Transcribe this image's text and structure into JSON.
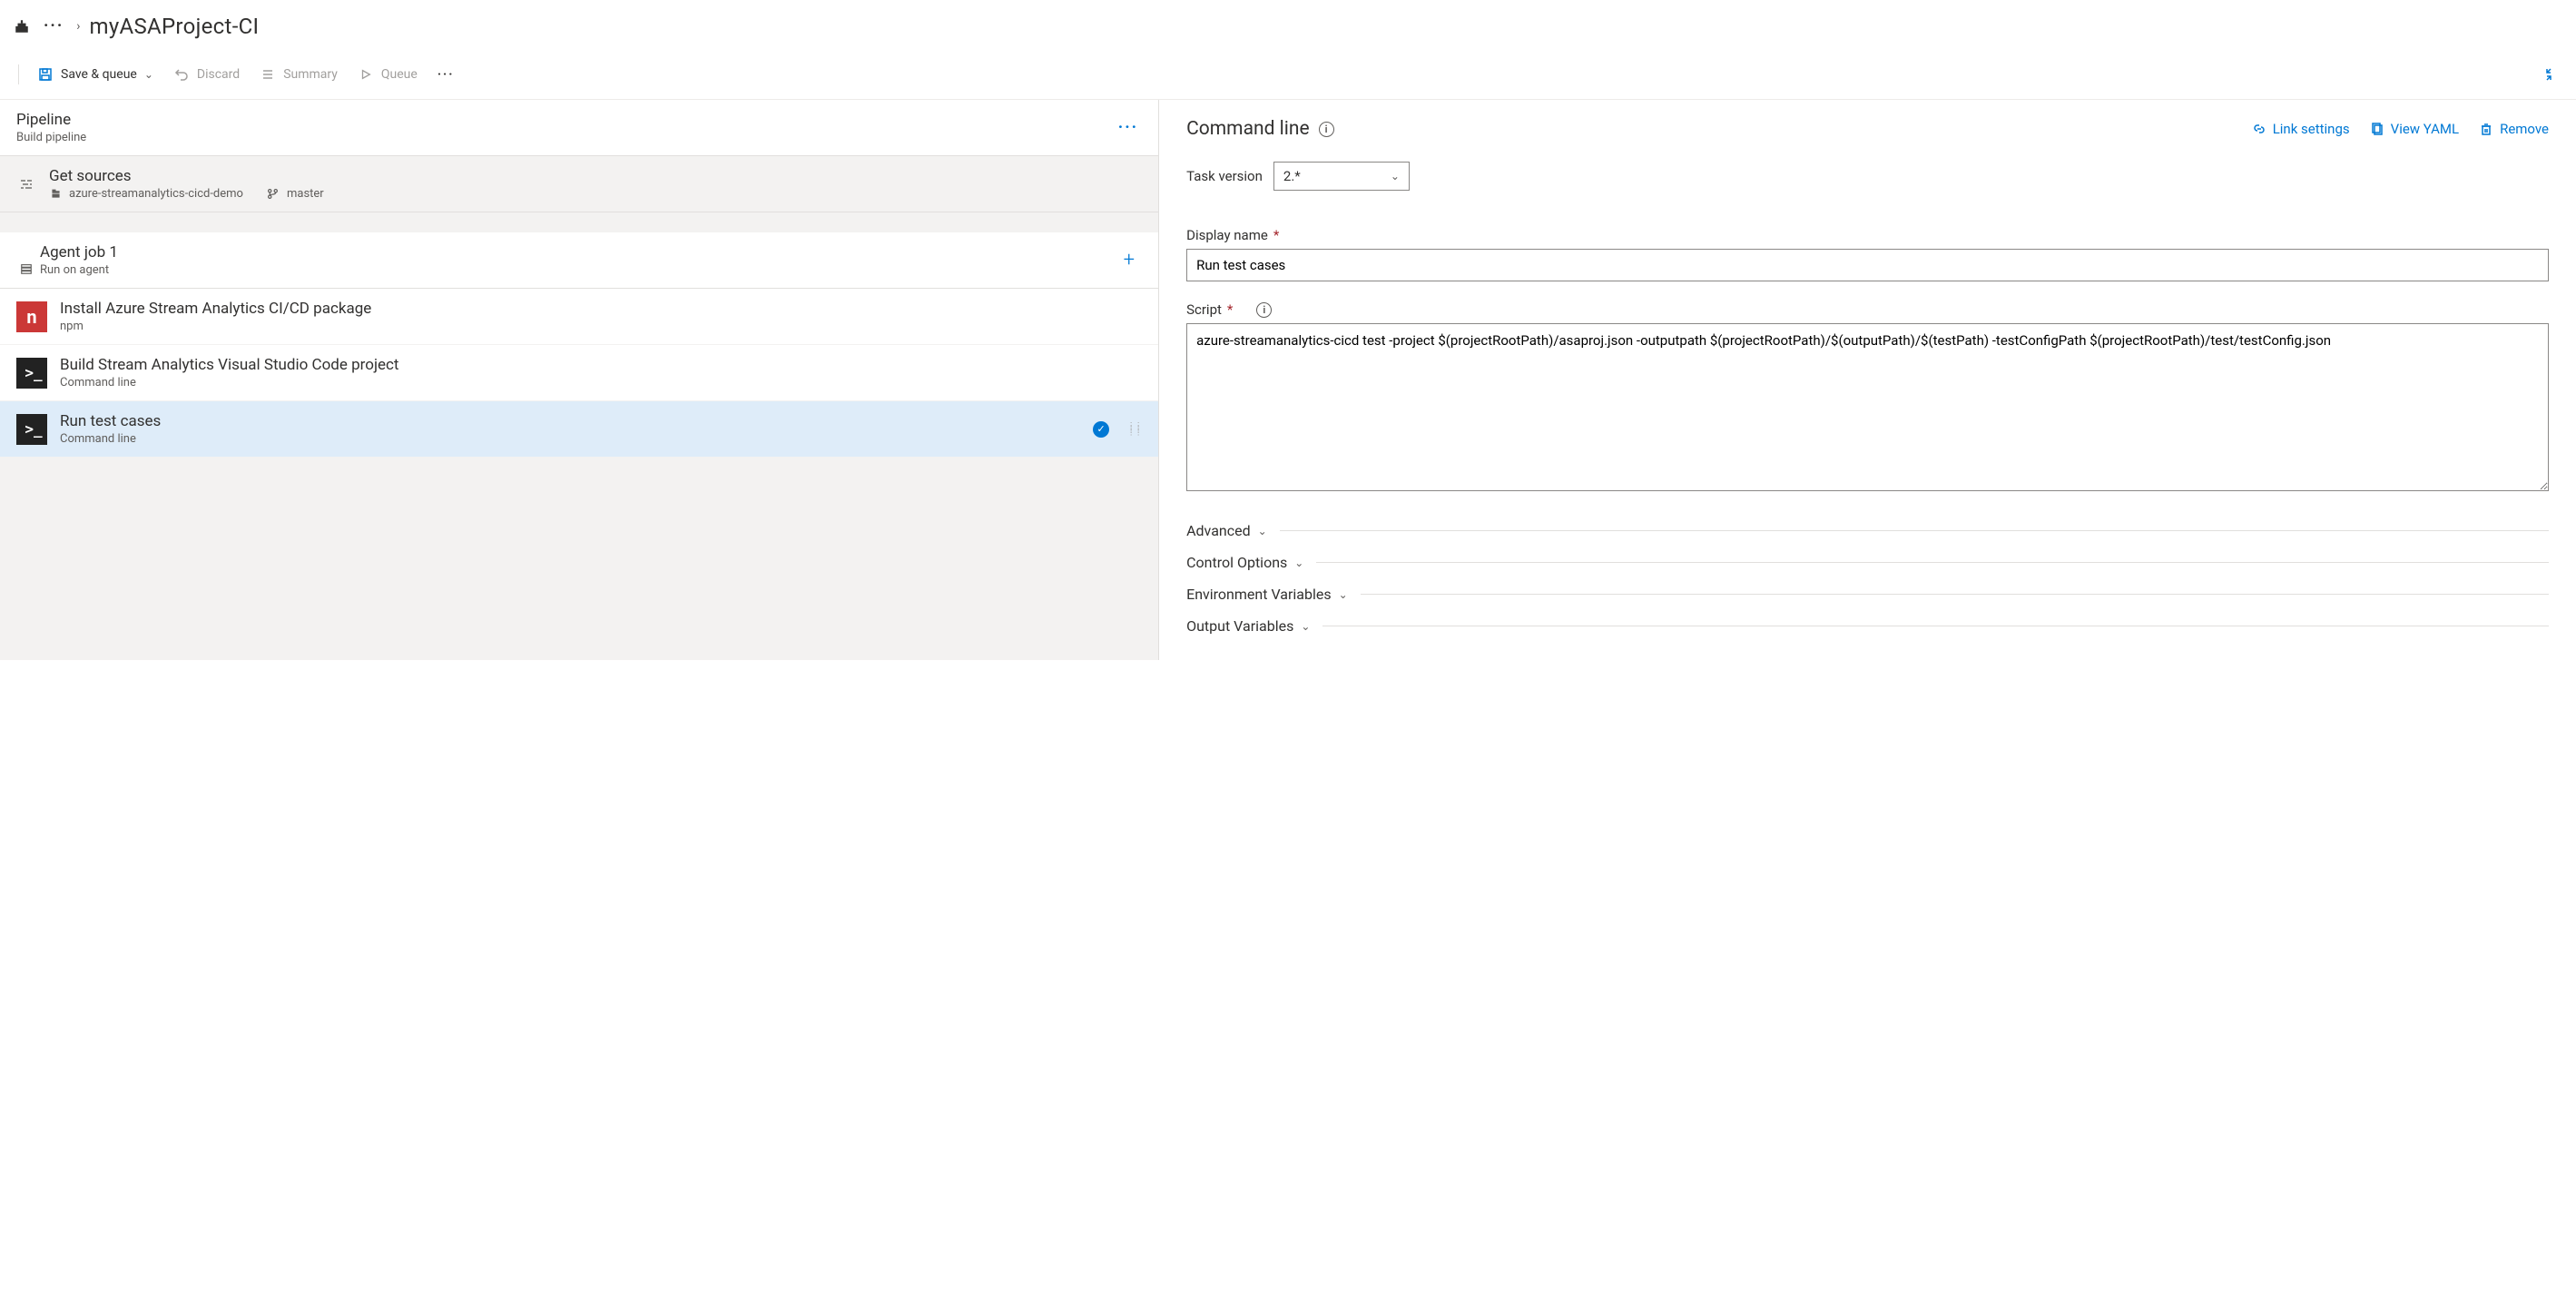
{
  "breadcrumb": {
    "ellipsis": "···",
    "title": "myASAProject-CI"
  },
  "toolbar": {
    "save_queue": "Save & queue",
    "discard": "Discard",
    "summary": "Summary",
    "queue": "Queue"
  },
  "pipeline": {
    "title": "Pipeline",
    "subtitle": "Build pipeline"
  },
  "get_sources": {
    "title": "Get sources",
    "repo": "azure-streamanalytics-cicd-demo",
    "branch": "master"
  },
  "agent_job": {
    "title": "Agent job 1",
    "subtitle": "Run on agent"
  },
  "tasks": [
    {
      "title": "Install Azure Stream Analytics CI/CD package",
      "subtitle": "npm",
      "iconType": "npm",
      "selected": false
    },
    {
      "title": "Build Stream Analytics Visual Studio Code project",
      "subtitle": "Command line",
      "iconType": "term",
      "selected": false
    },
    {
      "title": "Run test cases",
      "subtitle": "Command line",
      "iconType": "term",
      "selected": true
    }
  ],
  "detail": {
    "title": "Command line",
    "link_settings": "Link settings",
    "view_yaml": "View YAML",
    "remove": "Remove",
    "task_version_label": "Task version",
    "task_version_value": "2.*",
    "display_name_label": "Display name",
    "display_name_value": "Run test cases",
    "script_label": "Script",
    "script_value": "azure-streamanalytics-cicd test -project $(projectRootPath)/asaproj.json -outputpath $(projectRootPath)/$(outputPath)/$(testPath) -testConfigPath $(projectRootPath)/test/testConfig.json",
    "advanced": "Advanced",
    "control_options": "Control Options",
    "env_vars": "Environment Variables",
    "output_vars": "Output Variables"
  }
}
